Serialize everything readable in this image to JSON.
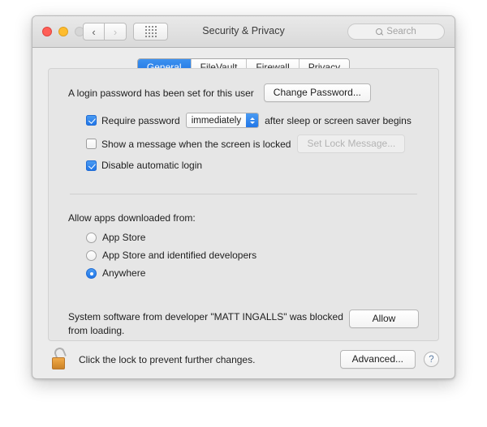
{
  "window": {
    "title": "Security & Privacy",
    "traffic_lights": [
      "close",
      "minimize",
      "zoom-disabled"
    ],
    "nav": {
      "back": "‹",
      "forward": "›"
    },
    "show_all_icon": "grid-icon",
    "search": {
      "placeholder": "Search",
      "value": "",
      "icon": "search-icon"
    }
  },
  "tabs": [
    {
      "label": "General",
      "active": true
    },
    {
      "label": "FileVault",
      "active": false
    },
    {
      "label": "Firewall",
      "active": false
    },
    {
      "label": "Privacy",
      "active": false
    }
  ],
  "login_password": {
    "status_text": "A login password has been set for this user",
    "change_button": "Change Password..."
  },
  "options": {
    "require_password": {
      "label": "Require password",
      "checked": true,
      "interval": "immediately",
      "suffix": "after sleep or screen saver begins"
    },
    "lock_message": {
      "label": "Show a message when the screen is locked",
      "checked": false,
      "button": "Set Lock Message...",
      "button_disabled": true
    },
    "disable_auto_login": {
      "label": "Disable automatic login",
      "checked": true
    }
  },
  "gatekeeper": {
    "heading": "Allow apps downloaded from:",
    "choices": [
      {
        "label": "App Store",
        "selected": false
      },
      {
        "label": "App Store and identified developers",
        "selected": false
      },
      {
        "label": "Anywhere",
        "selected": true
      }
    ]
  },
  "blocked_software": {
    "line1": "System software from developer \"MATT INGALLS\" was blocked",
    "line2": "from loading.",
    "allow_button": "Allow"
  },
  "footer": {
    "lock_icon": "unlocked-padlock-icon",
    "lock_text": "Click the lock to prevent further changes.",
    "advanced_button": "Advanced...",
    "help_button": "?"
  },
  "colors": {
    "accent": "#2176e8",
    "window_bg": "#ececec",
    "panel_bg": "#e6e6e6",
    "lock_body": "#dd9433"
  }
}
